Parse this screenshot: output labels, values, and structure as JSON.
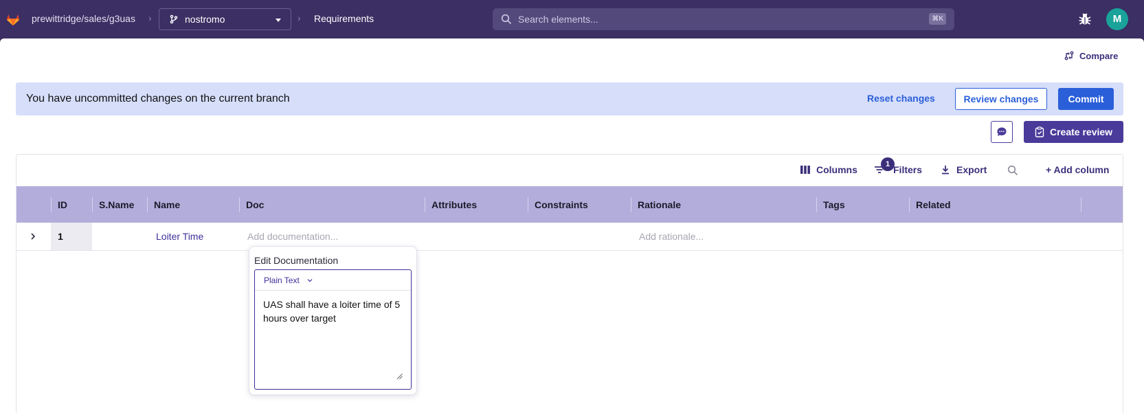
{
  "topbar": {
    "repo_path": "prewittridge/sales/g3uas",
    "branch": "nostromo",
    "page": "Requirements",
    "search_placeholder": "Search elements...",
    "search_shortcut": "⌘K",
    "avatar_initial": "M"
  },
  "compare_label": "Compare",
  "banner": {
    "message": "You have uncommitted changes on the current branch",
    "reset_label": "Reset changes",
    "review_label": "Review changes",
    "commit_label": "Commit"
  },
  "create_review_label": "Create review",
  "toolbar": {
    "columns_label": "Columns",
    "filters_label": "Filters",
    "filters_count": "1",
    "export_label": "Export",
    "add_column_label": "+ Add column"
  },
  "table": {
    "columns": [
      "ID",
      "S.Name",
      "Name",
      "Doc",
      "Attributes",
      "Constraints",
      "Rationale",
      "Tags",
      "Related"
    ],
    "rows": [
      {
        "id": "1",
        "sname": "",
        "name": "Loiter Time",
        "doc_placeholder": "Add documentation...",
        "rationale_placeholder": "Add rationale..."
      }
    ]
  },
  "popover": {
    "title": "Edit Documentation",
    "mode_label": "Plain Text",
    "content": "UAS shall have a loiter time of 5 hours over target"
  },
  "colors": {
    "topbar": "#3b2f63",
    "accent_blue": "#2b5fd9",
    "purple": "#4a3a9a",
    "header_row": "#b3addb",
    "banner": "#d6defa"
  }
}
